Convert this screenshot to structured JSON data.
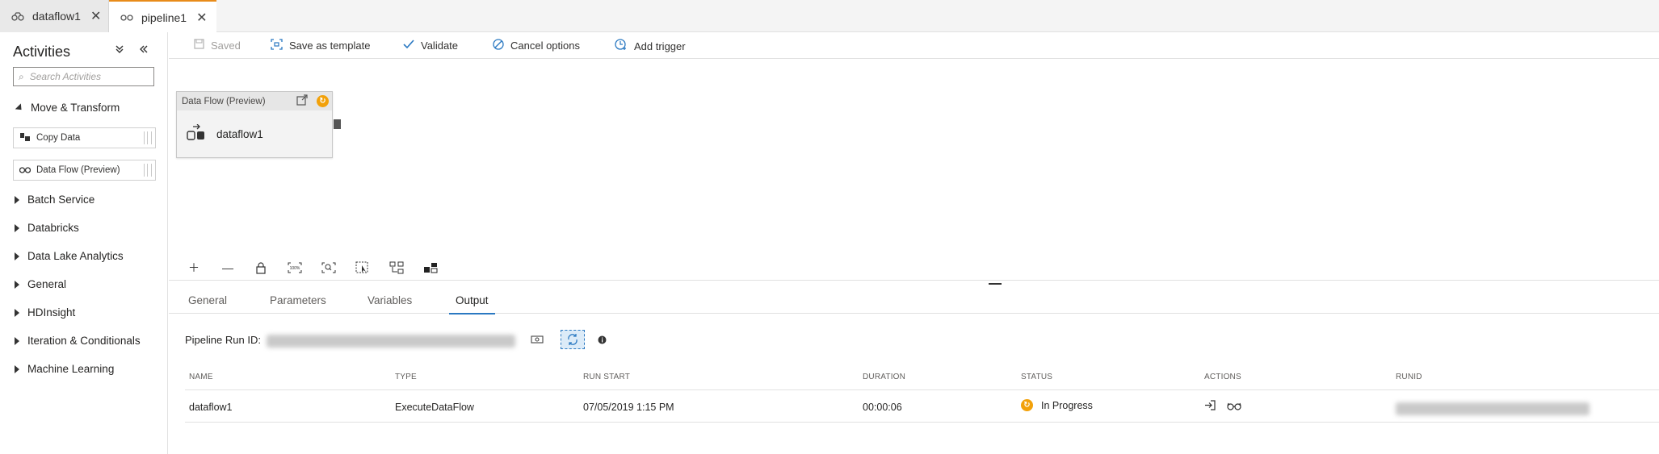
{
  "tabs": [
    {
      "label": "dataflow1",
      "icon": "dataflow-icon"
    },
    {
      "label": "pipeline1",
      "icon": "pipeline-icon"
    }
  ],
  "sidebar": {
    "title": "Activities",
    "search_placeholder": "Search Activities",
    "groups": [
      {
        "label": "Move & Transform",
        "expanded": true
      },
      {
        "label": "Batch Service"
      },
      {
        "label": "Databricks"
      },
      {
        "label": "Data Lake Analytics"
      },
      {
        "label": "General"
      },
      {
        "label": "HDInsight"
      },
      {
        "label": "Iteration & Conditionals"
      },
      {
        "label": "Machine Learning"
      }
    ],
    "activities": [
      {
        "label": "Copy Data",
        "icon": "copy-data-icon"
      },
      {
        "label": "Data Flow (Preview)",
        "icon": "data-flow-icon"
      }
    ]
  },
  "toolbar": {
    "saved": "Saved",
    "save_template": "Save as template",
    "validate": "Validate",
    "cancel_options": "Cancel options",
    "add_trigger": "Add trigger"
  },
  "canvas": {
    "node": {
      "header": "Data Flow (Preview)",
      "name": "dataflow1"
    }
  },
  "panel": {
    "tabs": [
      "General",
      "Parameters",
      "Variables",
      "Output"
    ],
    "active_tab": "Output",
    "run_id_label": "Pipeline Run ID:",
    "columns": [
      "NAME",
      "TYPE",
      "RUN START",
      "DURATION",
      "STATUS",
      "ACTIONS",
      "RUNID"
    ],
    "rows": [
      {
        "name": "dataflow1",
        "type": "ExecuteDataFlow",
        "run_start": "07/05/2019 1:15 PM",
        "duration": "00:00:06",
        "status": "In Progress"
      }
    ]
  },
  "colors": {
    "accent": "#2b79c2",
    "active_tab_border": "#e88b1a",
    "status_in_progress": "#f2a10a"
  }
}
